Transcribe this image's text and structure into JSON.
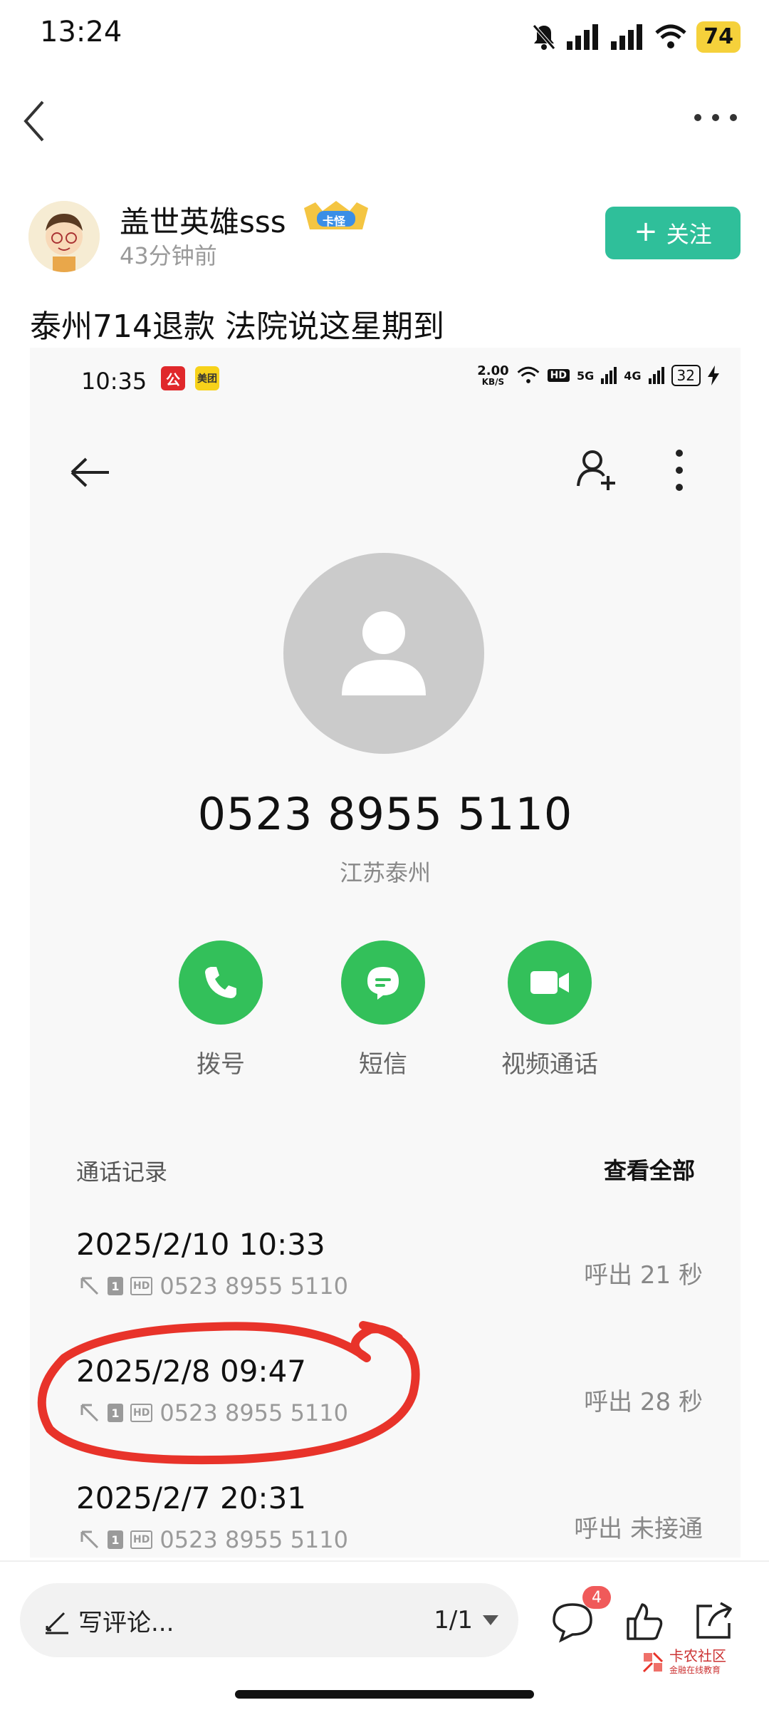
{
  "status_bar": {
    "time": "13:24",
    "battery": "74"
  },
  "post": {
    "author": "盖世英雄sss",
    "badge": "卡怪",
    "time_ago": "43分钟前",
    "follow_label": "关注",
    "title": "泰州714退款 法院说这星期到"
  },
  "screenshot": {
    "status": {
      "time": "10:35",
      "speed": "2.00",
      "speed_unit": "KB/S",
      "hd": "HD",
      "net1": "5G",
      "net2": "4G",
      "battery": "32"
    },
    "apps": [
      "公",
      "美团"
    ],
    "contact": {
      "number": "0523 8955 5110",
      "location": "江苏泰州"
    },
    "actions": [
      {
        "label": "拨号",
        "icon": "phone-icon"
      },
      {
        "label": "短信",
        "icon": "message-icon"
      },
      {
        "label": "视频通话",
        "icon": "video-icon"
      }
    ],
    "records_title": "通话记录",
    "records_view_all": "查看全部",
    "records": [
      {
        "datetime": "2025/2/10 10:33",
        "sim": "1",
        "hd": "HD",
        "number": "0523 8955 5110",
        "result": "呼出  21 秒"
      },
      {
        "datetime": "2025/2/8 09:47",
        "sim": "1",
        "hd": "HD",
        "number": "0523 8955 5110",
        "result": "呼出  28 秒"
      },
      {
        "datetime": "2025/2/7 20:31",
        "sim": "1",
        "hd": "HD",
        "number": "0523 8955 5110",
        "result": "呼出 未接通"
      }
    ]
  },
  "bottom_bar": {
    "comment_placeholder": "写评论...",
    "pager": "1/1",
    "comment_count": "4",
    "watermark_title": "卡农社区",
    "watermark_sub": "金融在线教育"
  },
  "colors": {
    "follow": "#2fbf9a",
    "action_green": "#33c05a",
    "annotation_red": "#e8332a",
    "badge_red": "#f05a5a"
  }
}
